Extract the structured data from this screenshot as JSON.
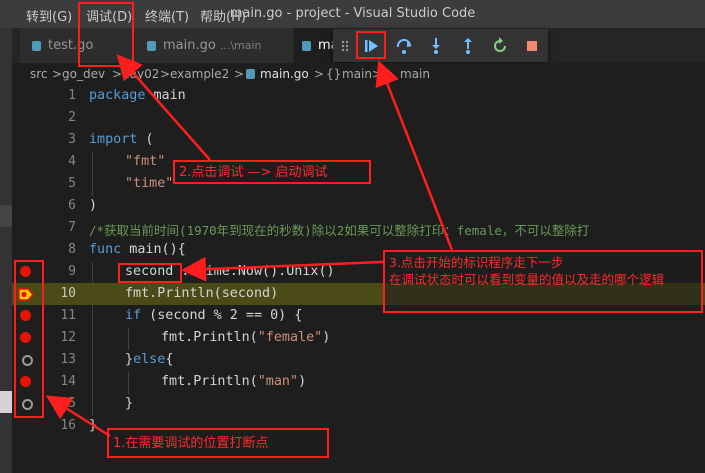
{
  "titlebar": {
    "menu": [
      "转到(G)",
      "调试(D)",
      "终端(T)",
      "帮助(H)"
    ],
    "window_title": "main.go - project - Visual Studio Code"
  },
  "tabs": [
    {
      "label": "test.go",
      "desc": ""
    },
    {
      "label": "main.go",
      "desc": "...\\main"
    },
    {
      "label": "ma",
      "desc": ""
    }
  ],
  "debug_toolbar": {
    "buttons": [
      "continue-icon",
      "step-over-icon",
      "step-into-icon",
      "step-out-icon",
      "restart-icon",
      "stop-icon"
    ]
  },
  "breadcrumb": {
    "parts": [
      "src",
      "go_dev",
      "day02",
      "example2",
      "main.go",
      "main",
      "main"
    ],
    "separator": ">"
  },
  "editor": {
    "lines": [
      {
        "n": "1",
        "text": "package main"
      },
      {
        "n": "2",
        "text": ""
      },
      {
        "n": "3",
        "text": "import ("
      },
      {
        "n": "4",
        "text": "\"fmt\""
      },
      {
        "n": "5",
        "text": "\"time\""
      },
      {
        "n": "6",
        "text": ")"
      },
      {
        "n": "7",
        "text": "/*获取当前时间(1970年到现在的秒数)除以2如果可以整除打印：female，不可以整除打"
      },
      {
        "n": "8",
        "text": "func main(){"
      },
      {
        "n": "9",
        "text": "second :=time.Now().Unix()"
      },
      {
        "n": "10",
        "text": "fmt.Println(second)"
      },
      {
        "n": "11",
        "text": "if (second % 2 == 0) {"
      },
      {
        "n": "12",
        "text": "fmt.Println(\"female\")"
      },
      {
        "n": "13",
        "text": "}else{"
      },
      {
        "n": "14",
        "text": "fmt.Println(\"man\")"
      },
      {
        "n": "15",
        "text": "}"
      },
      {
        "n": "16",
        "text": "}"
      }
    ]
  },
  "annotations": {
    "note1": "1.在需要调试的位置打断点",
    "note2": "2.点击调试 —> 启动调试",
    "note3": "3.点击开始的标识程序走下一步\n在调试状态时可以看到变量的值以及走的哪个逻辑"
  },
  "colors": {
    "breakpoint": "#e51400",
    "annotation": "#ff1e1e",
    "current_line": "#4b4b18"
  }
}
